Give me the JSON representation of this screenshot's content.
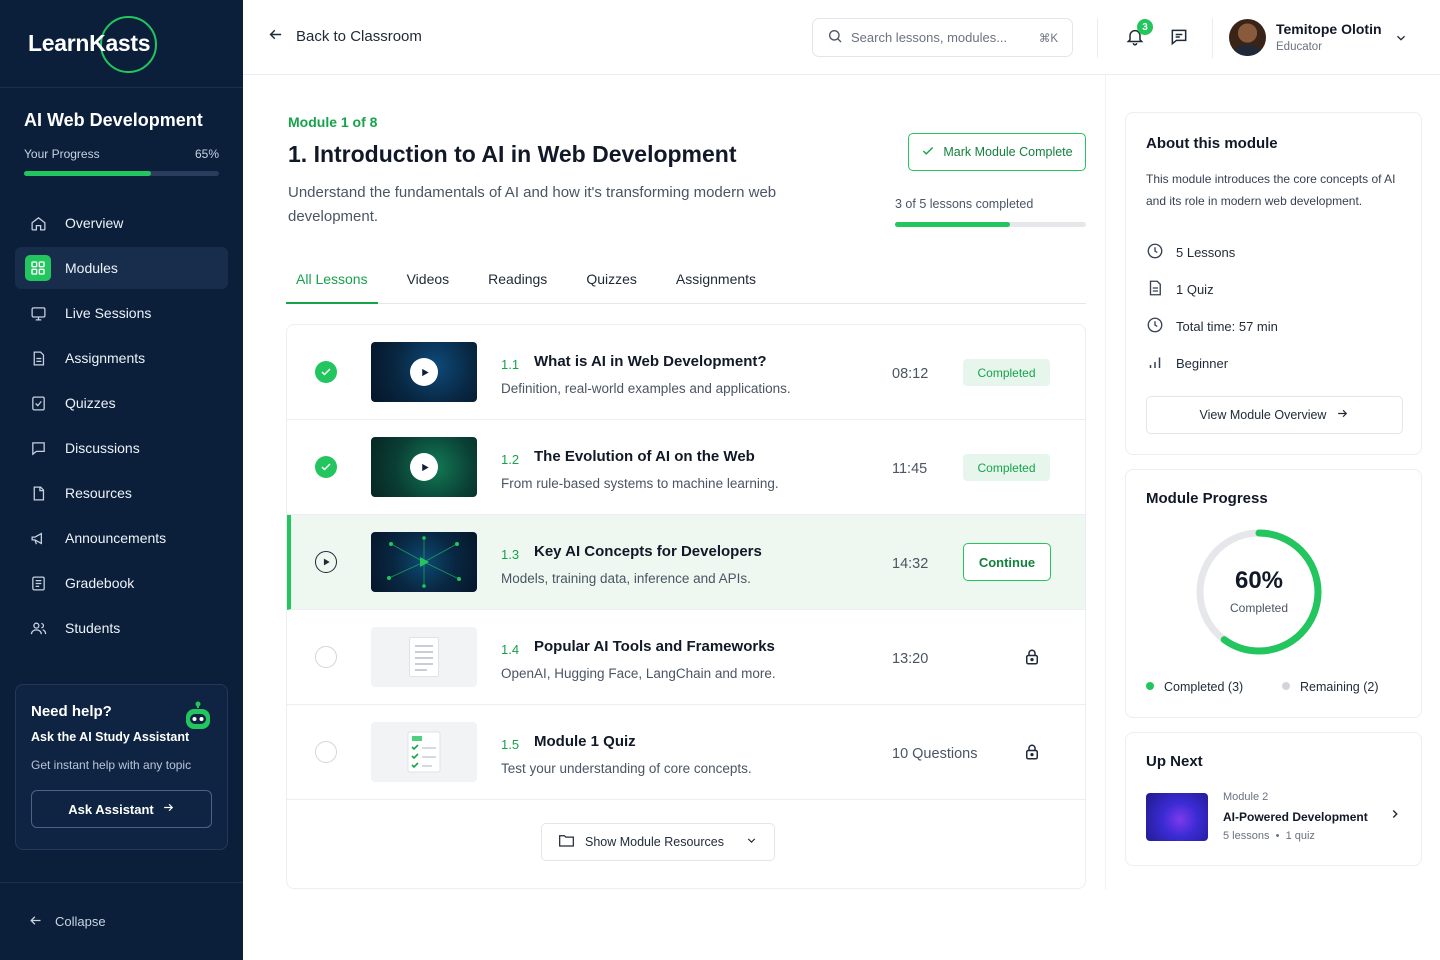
{
  "brand": {
    "name": "LearnKasts"
  },
  "sidebar": {
    "course_title": "AI Web Development",
    "progress_label": "Your Progress",
    "progress_value": "65%",
    "progress_fraction": 0.65,
    "nav": [
      {
        "label": "Overview",
        "icon": "home-icon"
      },
      {
        "label": "Modules",
        "icon": "modules-grid-icon",
        "active": true
      },
      {
        "label": "Live Sessions",
        "icon": "video-session-icon"
      },
      {
        "label": "Assignments",
        "icon": "document-icon"
      },
      {
        "label": "Quizzes",
        "icon": "quiz-icon"
      },
      {
        "label": "Discussions",
        "icon": "chat-bubble-icon"
      },
      {
        "label": "Resources",
        "icon": "file-icon"
      },
      {
        "label": "Announcements",
        "icon": "megaphone-icon"
      },
      {
        "label": "Gradebook",
        "icon": "gradebook-icon"
      },
      {
        "label": "Students",
        "icon": "users-icon"
      }
    ],
    "help": {
      "title": "Need help?",
      "subtitle": "Ask the AI Study Assistant",
      "description": "Get instant help with any topic",
      "button": "Ask Assistant"
    },
    "collapse_label": "Collapse"
  },
  "header": {
    "back_label": "Back to Classroom",
    "search_placeholder": "Search lessons, modules...",
    "search_shortcut": "⌘K",
    "notification_count": "3",
    "user": {
      "name": "Temitope Olotin",
      "role": "Educator"
    }
  },
  "module": {
    "label": "Module 1 of 8",
    "title": "1. Introduction to AI in Web Development",
    "description": "Understand the fundamentals of AI and how it's transforming modern web development.",
    "mark_complete_label": "Mark Module Complete",
    "lessons_completed_text": "3 of 5 lessons completed",
    "lessons_completed_fraction": 0.6
  },
  "tabs": [
    {
      "label": "All Lessons",
      "active": true
    },
    {
      "label": "Videos"
    },
    {
      "label": "Readings"
    },
    {
      "label": "Quizzes"
    },
    {
      "label": "Assignments"
    }
  ],
  "lessons": [
    {
      "num": "1.1",
      "title": "What is AI in Web Development?",
      "desc": "Definition, real-world examples and applications.",
      "duration": "08:12",
      "status": "completed",
      "status_label": "Completed"
    },
    {
      "num": "1.2",
      "title": "The Evolution of AI on the Web",
      "desc": "From rule-based systems to machine learning.",
      "duration": "11:45",
      "status": "completed",
      "status_label": "Completed"
    },
    {
      "num": "1.3",
      "title": "Key AI Concepts for Developers",
      "desc": "Models, training data, inference and APIs.",
      "duration": "14:32",
      "status": "current",
      "status_label": "Continue"
    },
    {
      "num": "1.4",
      "title": "Popular AI Tools and Frameworks",
      "desc": "OpenAI, Hugging Face, LangChain and more.",
      "duration": "13:20",
      "status": "locked"
    },
    {
      "num": "1.5",
      "title": "Module 1 Quiz",
      "desc": "Test your understanding of core concepts.",
      "duration": "10 Questions",
      "status": "locked"
    }
  ],
  "show_resources_label": "Show Module Resources",
  "about": {
    "title": "About this module",
    "description": "This module introduces the core concepts of AI and its role in modern web development.",
    "stats": [
      {
        "icon": "clock-icon",
        "label": "5 Lessons"
      },
      {
        "icon": "document-icon",
        "label": "1 Quiz"
      },
      {
        "icon": "clock-icon",
        "label": "Total time: 57 min"
      },
      {
        "icon": "level-bars-icon",
        "label": "Beginner"
      }
    ],
    "view_overview_label": "View Module Overview"
  },
  "module_progress": {
    "title": "Module Progress",
    "percent_text": "60%",
    "percent_fraction": 0.6,
    "center_label": "Completed",
    "legend_completed": "Completed (3)",
    "legend_remaining": "Remaining (2)",
    "colors": {
      "completed": "#22c55e",
      "remaining": "#e5e7eb"
    }
  },
  "up_next": {
    "title": "Up Next",
    "module": "Module 2",
    "name": "AI-Powered Development",
    "lessons": "5 lessons",
    "quiz": "1 quiz"
  },
  "colors": {
    "sidebar_bg": "#0b1f3a",
    "accent": "#22c55e",
    "accent_dark": "#16a34a"
  }
}
